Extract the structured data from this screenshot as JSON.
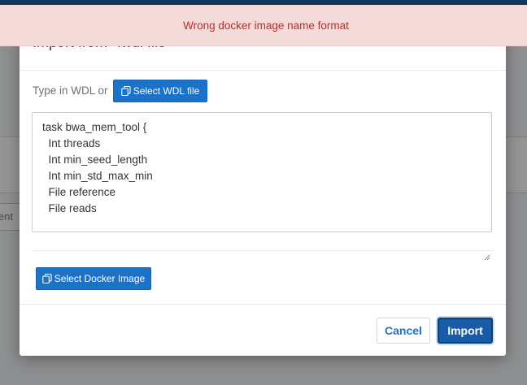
{
  "background": {
    "partial_input_text": "ent"
  },
  "modal": {
    "title": "Import from *.wdl file",
    "type_in_label": "Type in WDL or",
    "select_wdl_button": "Select WDL file",
    "wdl_content": "task bwa_mem_tool {\n  Int threads\n  Int min_seed_length\n  Int min_std_max_min\n  File reference\n  File reads",
    "select_docker_button": "Select Docker Image",
    "cancel_button": "Cancel",
    "import_button": "Import"
  },
  "error": {
    "message": "Wrong docker image name format"
  },
  "colors": {
    "primary": "#1a73c9",
    "error_bg": "#f5dada",
    "error_text": "#b7312c"
  },
  "icons": {
    "select_wdl": "copy-icon",
    "select_docker": "copy-icon"
  }
}
